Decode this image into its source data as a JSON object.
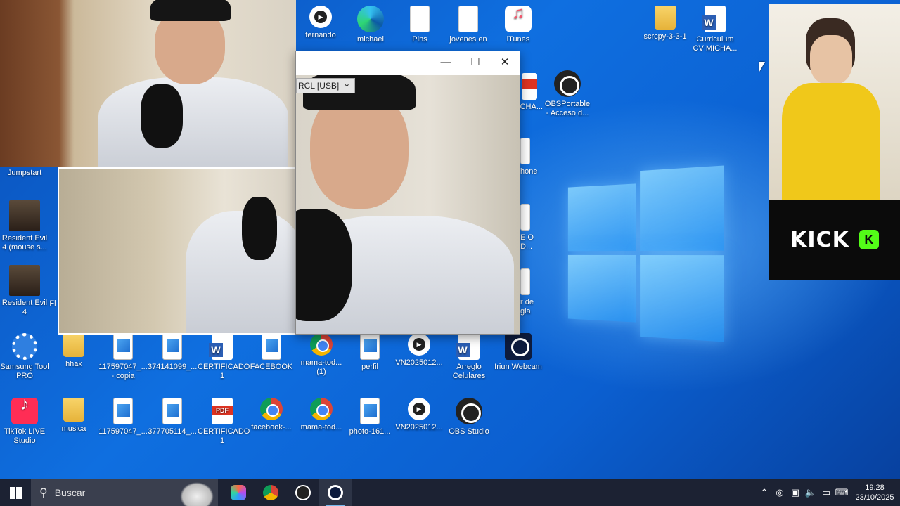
{
  "desktop": {
    "icons_top": [
      {
        "label": "fernando",
        "type": "media"
      },
      {
        "label": "michael",
        "type": "edge"
      },
      {
        "label": "Pins",
        "type": "doc"
      },
      {
        "label": "jovenes en",
        "type": "doc"
      },
      {
        "label": "iTunes",
        "type": "itunes"
      },
      {
        "label": "scrcpy-3-3-1",
        "type": "folder"
      },
      {
        "label": "Curriculum CV MICHA...",
        "type": "word"
      },
      {
        "label": "ulum CHA...",
        "type": "redpdf"
      },
      {
        "label": "OBSPortable - Acceso d...",
        "type": "obs"
      },
      {
        "label": "hone",
        "type": "doc"
      },
      {
        "label": "E O D...",
        "type": "doc"
      },
      {
        "label": "r de gia",
        "type": "doc"
      }
    ],
    "icons_left": [
      {
        "label": "Jumpstart"
      },
      {
        "label": "Resident Evil 4 (mouse s..."
      },
      {
        "label": "Resident Evil 4"
      },
      {
        "label": "Fi"
      }
    ],
    "row1": [
      {
        "label": "Samsung Tool PRO",
        "type": "gear"
      },
      {
        "label": "hhak",
        "type": "folder"
      },
      {
        "label": "117597047_... - copia",
        "type": "pic"
      },
      {
        "label": "374141099_...",
        "type": "pic"
      },
      {
        "label": "CERTIFICADO 1",
        "type": "word"
      },
      {
        "label": "FACEBOOK",
        "type": "pic"
      },
      {
        "label": "mama-tod... (1)",
        "type": "chrome"
      },
      {
        "label": "perfil",
        "type": "pic"
      },
      {
        "label": "VN2025012...",
        "type": "media"
      },
      {
        "label": "Arreglo Celulares",
        "type": "word"
      },
      {
        "label": "Iriun Webcam",
        "type": "webcam"
      }
    ],
    "row2": [
      {
        "label": "TikTok LIVE Studio",
        "type": "tiktok"
      },
      {
        "label": "musica",
        "type": "folder"
      },
      {
        "label": "117597047_...",
        "type": "pic"
      },
      {
        "label": "377705114_...",
        "type": "pic"
      },
      {
        "label": "CERTIFICADO 1",
        "type": "pdf"
      },
      {
        "label": "facebook-...",
        "type": "chrome"
      },
      {
        "label": "mama-tod...",
        "type": "chrome"
      },
      {
        "label": "photo-161...",
        "type": "pic"
      },
      {
        "label": "VN2025012...",
        "type": "media"
      },
      {
        "label": "OBS Studio",
        "type": "obs"
      }
    ]
  },
  "window": {
    "minimize": "—",
    "maximize": "☐",
    "close": "✕",
    "device_select": "RCL [USB]"
  },
  "kick": {
    "word": "KICK",
    "logo": "K"
  },
  "taskbar": {
    "search_placeholder": "Buscar",
    "time": "19:28",
    "date": "23/10/2025"
  }
}
